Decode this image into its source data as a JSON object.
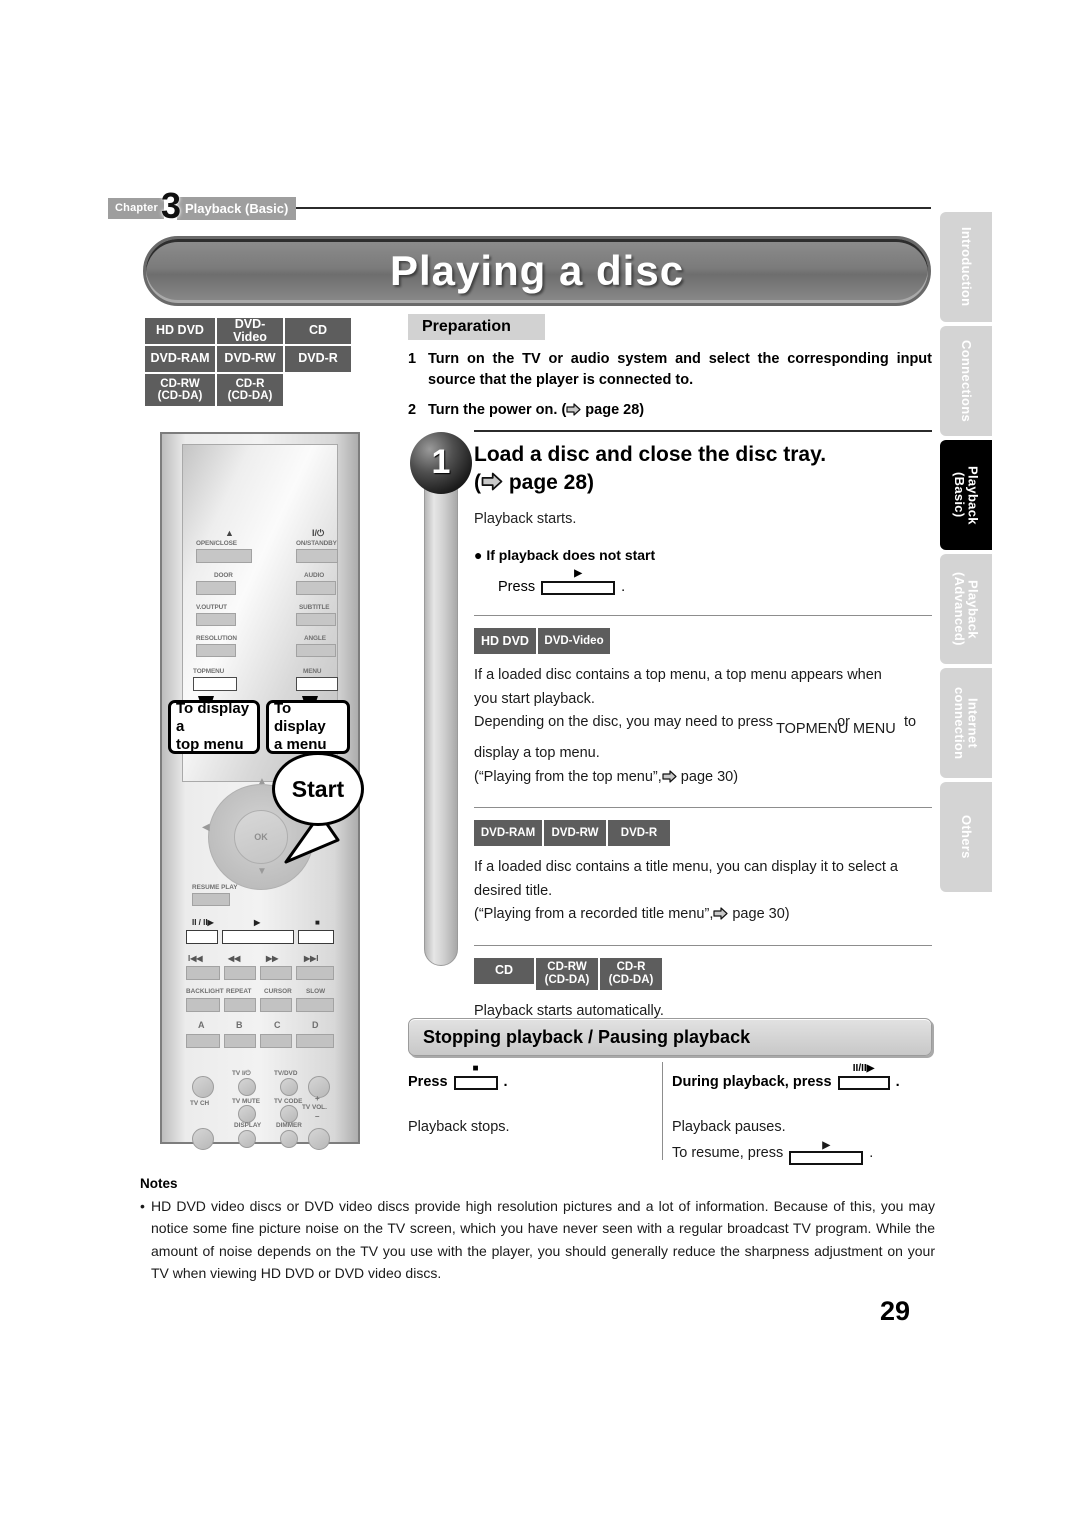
{
  "chapter": {
    "word": "Chapter",
    "number": "3",
    "title": "Playback (Basic)"
  },
  "page_title": "Playing a disc",
  "page_number": "29",
  "disc_key": [
    [
      "HD DVD",
      "DVD-Video",
      "CD"
    ],
    [
      "DVD-RAM",
      "DVD-RW",
      "DVD-R"
    ],
    [
      "CD-RW\n(CD-DA)",
      "CD-R\n(CD-DA)"
    ]
  ],
  "disc_key_flat": {
    "r1c1": "HD DVD",
    "r1c2": "DVD-Video",
    "r1c3": "CD",
    "r2c1": "DVD-RAM",
    "r2c2": "DVD-RW",
    "r2c3": "DVD-R",
    "r3c1a": "CD-RW",
    "r3c1b": "(CD-DA)",
    "r3c2a": "CD-R",
    "r3c2b": "(CD-DA)"
  },
  "preparation": {
    "heading": "Preparation",
    "items": [
      {
        "num": "1",
        "text": "Turn on the TV or audio system and select the corresponding input source that the player is connected to."
      },
      {
        "num": "2",
        "text": "Turn the power on. (⇨ page 28)"
      },
      {
        "num": "2",
        "text_a": "Turn the power on. (",
        "text_b": " page 28)"
      }
    ]
  },
  "step1": {
    "number": "1",
    "title_line1": "Load a disc and close the disc tray.",
    "title_line2_a": "(",
    "title_line2_b": " page 28)",
    "sub": "Playback starts.",
    "bullet": "● If playback does not start",
    "press_label": "Press",
    "press_key_glyph": "▶",
    "press_period": ".",
    "blocks": [
      {
        "badges": [
          "HD DVD",
          "DVD-Video"
        ],
        "line1": "If a loaded disc contains a top menu, a top menu appears when",
        "line2": "you start playback.",
        "line3_a": "Depending on the disc, you may need to press",
        "line3_key1": "TOPMENU",
        "line3_or": "or",
        "line3_key2": "MENU",
        "line3_b": "to",
        "line4": "display a top menu.",
        "line5_a": "(“Playing from the top menu”,",
        "line5_b": " page 30)"
      },
      {
        "badges": [
          "DVD-RAM",
          "DVD-RW",
          "DVD-R"
        ],
        "line1": "If a loaded disc contains a title menu, you can display it to select a",
        "line2": "desired title.",
        "line5_a": "(“Playing from a recorded title menu”,",
        "line5_b": " page 30)"
      },
      {
        "badges": [
          "CD",
          "CD-RW\n(CD-DA)",
          "CD-R\n(CD-DA)"
        ],
        "line1": "Playback starts automatically."
      }
    ]
  },
  "section": {
    "heading": "Stopping playback / Pausing playback",
    "stop": {
      "head_a": "Press",
      "head_key_glyph": "■",
      "head_b": ".",
      "body": "Playback stops."
    },
    "pause": {
      "head_a": "During playback, press",
      "head_key_glyph": "II/II▶",
      "head_b": ".",
      "body_line1": "Playback pauses.",
      "body_line2_a": "To resume, press",
      "body_line2_key": "▶",
      "body_line2_b": "."
    }
  },
  "notes": {
    "heading": "Notes",
    "items": [
      "HD DVD video discs or DVD video discs provide high resolution pictures and a lot of information. Because of this, you may notice some fine picture noise on the TV screen, which you have never seen with a regular broadcast TV program. While the amount of noise depends on the TV you use with the player, you should generally reduce the sharpness adjustment on your TV when viewing HD DVD or DVD video discs."
    ]
  },
  "side_tabs": [
    {
      "label": "Introduction",
      "active": false
    },
    {
      "label": "Connections",
      "active": false
    },
    {
      "label": "Playback\n(Basic)",
      "active": true
    },
    {
      "label": "Playback\n(Advanced)",
      "active": false
    },
    {
      "label": "Internet\nconnection",
      "active": false
    },
    {
      "label": "Others",
      "active": false
    }
  ],
  "side_tabs_flat": {
    "t0": "Introduction",
    "t1": "Connections",
    "t2a": "Playback",
    "t2b": "(Basic)",
    "t3a": "Playback",
    "t3b": "(Advanced)",
    "t4a": "Internet",
    "t4b": "connection",
    "t5": "Others"
  },
  "remote": {
    "labels": {
      "open_close": "OPEN/CLOSE",
      "on_standby": "ON/STANDBY",
      "door": "DOOR",
      "audio": "AUDIO",
      "v_output": "V.OUTPUT",
      "subtitle": "SUBTITLE",
      "resolution": "RESOLUTION",
      "angle": "ANGLE",
      "topmenu": "TOPMENU",
      "menu": "MENU",
      "ok": "OK",
      "resume_play": "RESUME PLAY",
      "pause": "II / II▶",
      "play": "▶",
      "stop": "■",
      "skip_back": "I◀◀",
      "rew": "◀◀",
      "ff": "▶▶",
      "skip_fwd": "▶▶I",
      "backlight": "BACKLIGHT",
      "repeat": "REPEAT",
      "cursor": "CURSOR",
      "slow": "SLOW",
      "a": "A",
      "b": "B",
      "c": "C",
      "d": "D",
      "tv_power": "TV  I/⏻",
      "tv_dvd": "TV/DVD",
      "tv_mute": "TV MUTE",
      "tv_code": "TV CODE",
      "display": "DISPLAY",
      "dimmer": "DIMMER",
      "tv_ch": "TV CH",
      "tv_vol": "TV VOL.",
      "plus": "+",
      "minus": "–",
      "eject_icon": "▲",
      "power_icon": "I/⏻"
    },
    "callouts": {
      "top_menu_a": "To display a",
      "top_menu_b": "top menu",
      "menu_a": "To display",
      "menu_b": "a menu",
      "start": "Start"
    }
  },
  "colors": {
    "badge_bg": "#5d5d5d",
    "chapter_bg": "#9e9e9e",
    "banner_gray": "#7b7b7b",
    "tab_inactive": "#d4d4d4",
    "tab_active": "#000000",
    "section_bg": "#d2d2d2"
  }
}
